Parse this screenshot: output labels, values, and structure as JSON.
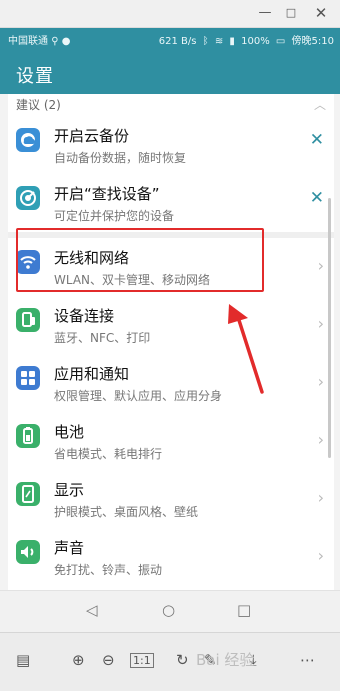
{
  "window_controls": {
    "minimize": "—",
    "maximize": "□",
    "close": "✕"
  },
  "status_bar": {
    "carrier": "中国联通",
    "speed": "621 B/s",
    "battery": "100%",
    "time": "傍晚5:10"
  },
  "header": {
    "title": "设置"
  },
  "suggestions": {
    "label": "建议 (2)",
    "items": [
      {
        "title": "开启云备份",
        "subtitle": "自动备份数据，随时恢复",
        "icon": "cloud-backup-icon",
        "color": "#3a8fd6"
      },
      {
        "title": "开启“查找设备”",
        "subtitle": "可定位并保护您的设备",
        "icon": "find-device-icon",
        "color": "#2f9fb5"
      }
    ]
  },
  "settings": {
    "items": [
      {
        "title": "无线和网络",
        "subtitle": "WLAN、双卡管理、移动网络",
        "icon": "wifi-icon",
        "color": "#3e7bd1"
      },
      {
        "title": "设备连接",
        "subtitle": "蓝牙、NFC、打印",
        "icon": "device-connect-icon",
        "color": "#3ab06a"
      },
      {
        "title": "应用和通知",
        "subtitle": "权限管理、默认应用、应用分身",
        "icon": "apps-icon",
        "color": "#3e7bd1"
      },
      {
        "title": "电池",
        "subtitle": "省电模式、耗电排行",
        "icon": "battery-icon",
        "color": "#3ab06a"
      },
      {
        "title": "显示",
        "subtitle": "护眼模式、桌面风格、壁纸",
        "icon": "display-icon",
        "color": "#3ab06a"
      },
      {
        "title": "声音",
        "subtitle": "免打扰、铃声、振动",
        "icon": "sound-icon",
        "color": "#3ab06a"
      }
    ]
  },
  "navbar": {
    "back": "◁",
    "home": "○",
    "recents": "□"
  },
  "viewer": {
    "zoom_in": "⊕",
    "zoom_out": "⊖",
    "actual_size": "1:1",
    "watermark": "Bai 经验"
  }
}
